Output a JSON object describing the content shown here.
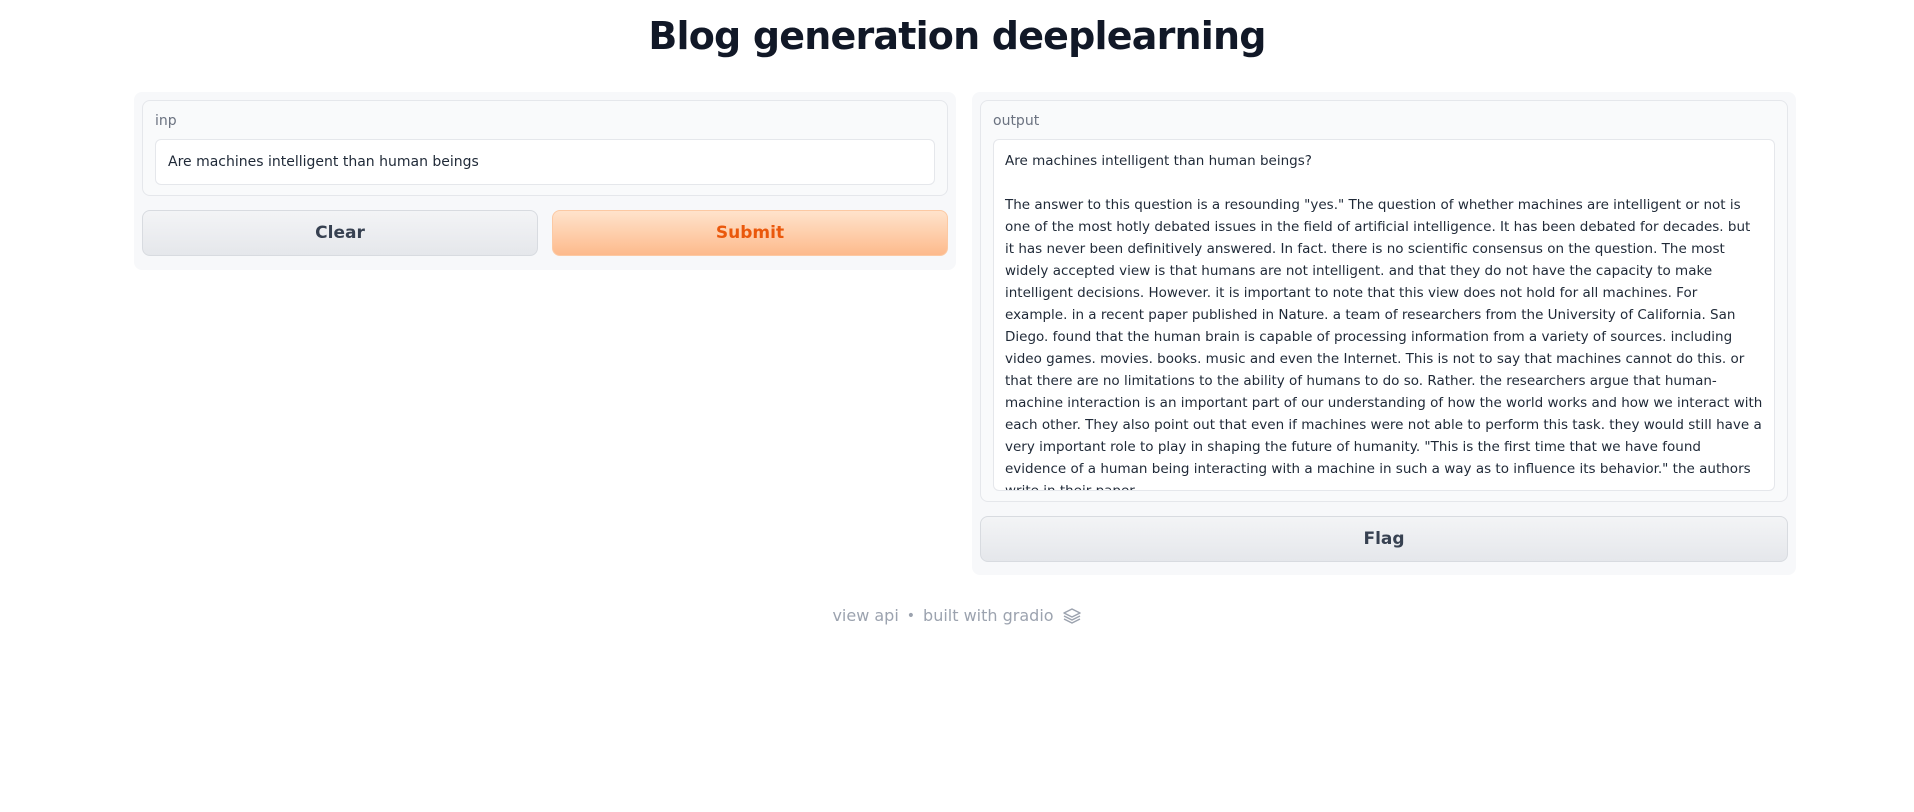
{
  "page": {
    "title": "Blog generation deeplearning"
  },
  "input_panel": {
    "label": "inp",
    "value": "Are machines intelligent than human beings",
    "clear_label": "Clear",
    "submit_label": "Submit"
  },
  "output_panel": {
    "label": "output",
    "first_line": "Are machines intelligent than human beings?",
    "body": "The answer to this question is a resounding \"yes.\" The question of whether machines are intelligent or not is one of the most hotly debated issues in the field of artificial intelligence. It has been debated for decades. but it has never been definitively answered. In fact. there is no scientific consensus on the question. The most widely accepted view is that humans are not intelligent. and that they do not have the capacity to make intelligent decisions. However. it is important to note that this view does not hold for all machines. For example. in a recent paper published in Nature. a team of researchers from the University of California. San Diego. found that the human brain is capable of processing information from a variety of sources. including video games. movies. books. music and even the Internet. This is not to say that machines cannot do this. or that there are no limitations to the ability of humans to do so. Rather. the researchers argue that human-machine interaction is an important part of our understanding of how the world works and how we interact with each other. They also point out that even if machines were not able to perform this task. they would still have a very important role to play in shaping the future of humanity. \"This is the first time that we have found evidence of a human being interacting with a machine in such a way as to influence its behavior.\" the authors write in their paper.",
    "flag_label": "Flag"
  },
  "footer": {
    "view_api": "view api",
    "separator": "•",
    "built_with": "built with gradio",
    "logo_icon": "gradio-logo-icon"
  },
  "colors": {
    "primary_text": "#ea580c",
    "primary_bg_start": "#ffe3cc",
    "primary_bg_end": "#fdba8c"
  }
}
